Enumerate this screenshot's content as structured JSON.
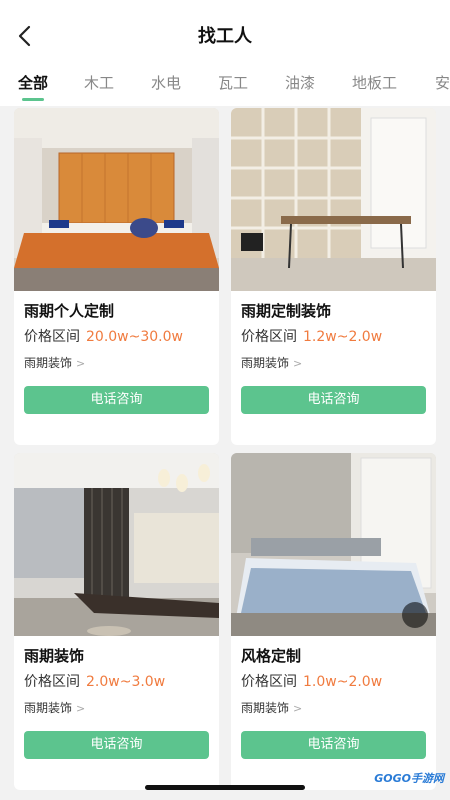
{
  "header": {
    "title": "找工人"
  },
  "tabs": [
    {
      "label": "全部"
    },
    {
      "label": "木工"
    },
    {
      "label": "水电"
    },
    {
      "label": "瓦工"
    },
    {
      "label": "油漆"
    },
    {
      "label": "地板工"
    },
    {
      "label": "安"
    }
  ],
  "cards": [
    {
      "name": "雨期个人定制",
      "price_label": "价格区间",
      "price": "20.0w~30.0w",
      "company": "雨期装饰",
      "button": "电话咨询"
    },
    {
      "name": "雨期定制装饰",
      "price_label": "价格区间",
      "price": "1.2w~2.0w",
      "company": "雨期装饰",
      "button": "电话咨询"
    },
    {
      "name": "雨期装饰",
      "price_label": "价格区间",
      "price": "2.0w~3.0w",
      "company": "雨期装饰",
      "button": "电话咨询"
    },
    {
      "name": "风格定制",
      "price_label": "价格区间",
      "price": "1.0w~2.0w",
      "company": "雨期装饰",
      "button": "电话咨询"
    }
  ],
  "watermark": "GOGO手游网",
  "colors": {
    "accent": "#5cc48e",
    "price": "#f07b3f"
  }
}
